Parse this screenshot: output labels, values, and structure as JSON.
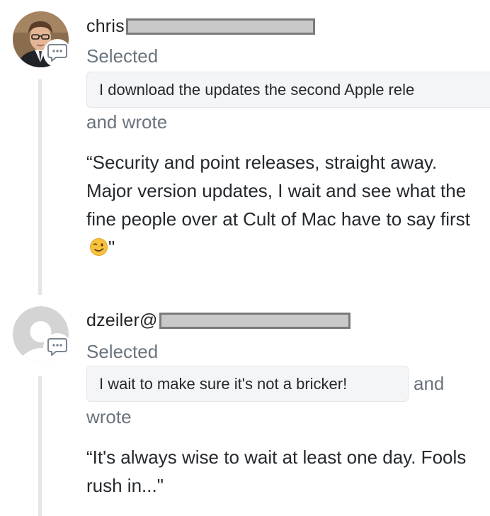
{
  "comments": [
    {
      "username": "chris",
      "selected_label": "Selected",
      "quote": "I download the updates the second Apple rele",
      "and_wrote_label": "and wrote",
      "body": "“Security and point releases, straight away. Major version updates, I wait and see what the fine people over at Cult of Mac have to say first",
      "body_end": "\"",
      "avatar_icon": "user-photo-avatar",
      "action_icon": "comment-bubble-icon",
      "emoji_icon": "winking-face-emoji"
    },
    {
      "username": "dzeiler@",
      "selected_label": "Selected",
      "quote": "I wait to make sure it's not a bricker!",
      "and_label": "and",
      "wrote_label": "wrote",
      "body": "“It's always wise to wait at least one day. Fools rush in...\"",
      "avatar_icon": "default-user-avatar",
      "action_icon": "comment-bubble-icon"
    }
  ],
  "colors": {
    "text": "#24292e",
    "muted_text": "#6a737d",
    "quote_background": "#f3f5f7",
    "thread_line": "#e3e6ea",
    "redaction_fill": "#c9c9c9"
  }
}
